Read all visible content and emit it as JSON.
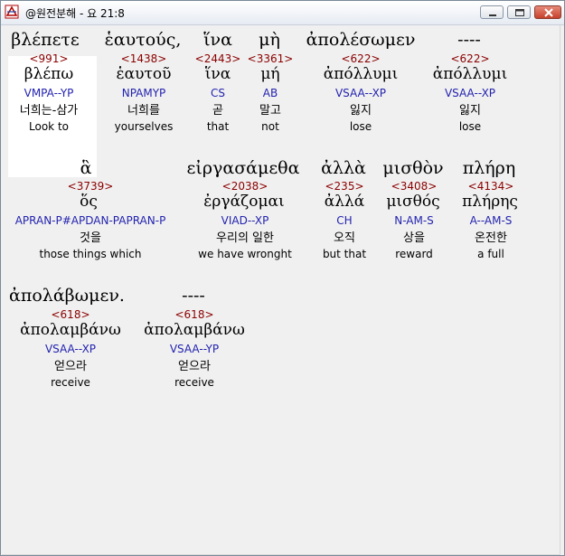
{
  "window": {
    "title": "@원전분해 - 요 21:8"
  },
  "lines": [
    [
      {
        "greek": "βλέπετε",
        "strong": "<991>",
        "lemma": "βλέπω",
        "morph": "VMPA--YP",
        "korean": "너희는-삼가",
        "english": "Look to"
      },
      {
        "greek": "ἑαυτούς,",
        "strong": "<1438>",
        "lemma": "ἑαυτοῦ",
        "morph": "NPAMYP",
        "korean": "너희를",
        "english": "yourselves"
      },
      {
        "greek": "ἵνα",
        "strong": "<2443>",
        "lemma": "ἵνα",
        "morph": "CS",
        "korean": "곧",
        "english": "that"
      },
      {
        "greek": "μὴ",
        "strong": "<3361>",
        "lemma": "μή",
        "morph": "AB",
        "korean": "말고",
        "english": "not"
      },
      {
        "greek": "ἀπολέσωμεν",
        "strong": "<622>",
        "lemma": "ἀπόλλυμι",
        "morph": "VSAA--XP",
        "korean": "잃지",
        "english": "lose"
      },
      {
        "greek": "----",
        "strong": "<622>",
        "lemma": "ἀπόλλυμι",
        "morph": "VSAA--XP",
        "korean": "잃지",
        "english": "lose"
      }
    ],
    [
      {
        "greek": "ἃ",
        "strong": "<3739>",
        "lemma": "ὅς",
        "morph": "APRAN-P#APDAN-PAPRAN-P",
        "korean": "것을",
        "english": "those things which"
      },
      {
        "greek": "εἰργασάμεθα",
        "strong": "<2038>",
        "lemma": "ἐργάζομαι",
        "morph": "VIAD--XP",
        "korean": "우리의 일한",
        "english": "we have wronght"
      },
      {
        "greek": "ἀλλὰ",
        "strong": "<235>",
        "lemma": "ἀλλά",
        "morph": "CH",
        "korean": "오직",
        "english": "but that"
      },
      {
        "greek": "μισθὸν",
        "strong": "<3408>",
        "lemma": "μισθός",
        "morph": "N-AM-S",
        "korean": "상을",
        "english": "reward"
      },
      {
        "greek": "πλήρη",
        "strong": "<4134>",
        "lemma": "πλήρης",
        "morph": "A--AM-S",
        "korean": "온전한",
        "english": "a full"
      }
    ],
    [
      {
        "greek": "ἀπολάβωμεν.",
        "strong": "<618>",
        "lemma": "ἀπολαμβάνω",
        "morph": "VSAA--XP",
        "korean": "얻으라",
        "english": "receive"
      },
      {
        "greek": "----",
        "strong": "<618>",
        "lemma": "ἀπολαμβάνω",
        "morph": "VSAA--YP",
        "korean": "얻으라",
        "english": "receive"
      }
    ]
  ]
}
